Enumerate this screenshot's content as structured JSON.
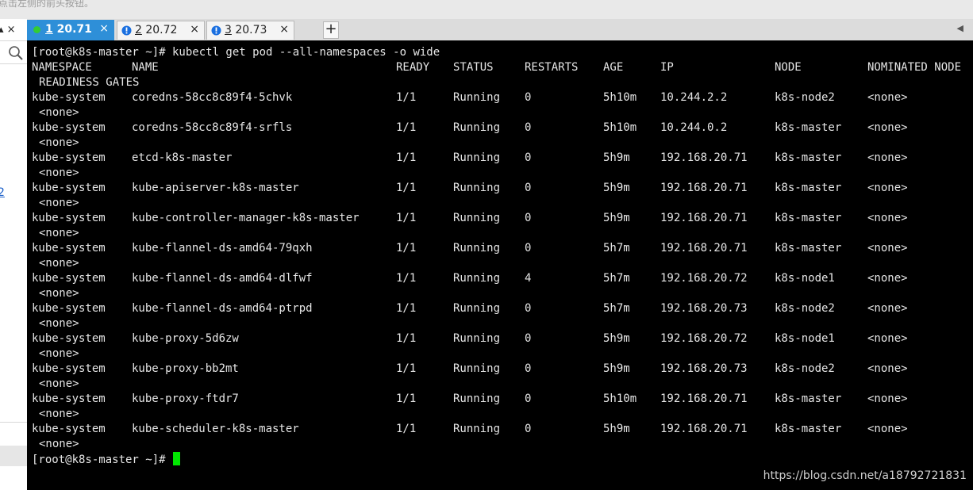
{
  "hint_text": "点击左侧的前头按钮。",
  "sidebar": {
    "controls_label": "▴ ×",
    "link_text": "2"
  },
  "tabs": [
    {
      "number": "1",
      "label": " 20.71",
      "status": "connected",
      "status_color": "#33cc33"
    },
    {
      "number": "2",
      "label": " 20.72",
      "status": "warning",
      "status_color": "#1a6fe0"
    },
    {
      "number": "3",
      "label": " 20.73",
      "status": "warning",
      "status_color": "#1a6fe0"
    }
  ],
  "new_tab_label": "+",
  "tab_close_label": "×",
  "terminal": {
    "prompt": "[root@k8s-master ~]#",
    "command": " kubectl get pod --all-namespaces -o wide",
    "headers": [
      "NAMESPACE",
      "NAME",
      "READY",
      "STATUS",
      "RESTARTS",
      "AGE",
      "IP",
      "NODE",
      "NOMINATED NODE"
    ],
    "headers_wrap": "READINESS GATES",
    "rows": [
      {
        "namespace": "kube-system",
        "name": "coredns-58cc8c89f4-5chvk",
        "ready": "1/1",
        "status": "Running",
        "restarts": "0",
        "age": "5h10m",
        "ip": "10.244.2.2",
        "node": "k8s-node2",
        "nominated": "<none>",
        "gates": "<none>"
      },
      {
        "namespace": "kube-system",
        "name": "coredns-58cc8c89f4-srfls",
        "ready": "1/1",
        "status": "Running",
        "restarts": "0",
        "age": "5h10m",
        "ip": "10.244.0.2",
        "node": "k8s-master",
        "nominated": "<none>",
        "gates": "<none>"
      },
      {
        "namespace": "kube-system",
        "name": "etcd-k8s-master",
        "ready": "1/1",
        "status": "Running",
        "restarts": "0",
        "age": "5h9m",
        "ip": "192.168.20.71",
        "node": "k8s-master",
        "nominated": "<none>",
        "gates": "<none>"
      },
      {
        "namespace": "kube-system",
        "name": "kube-apiserver-k8s-master",
        "ready": "1/1",
        "status": "Running",
        "restarts": "0",
        "age": "5h9m",
        "ip": "192.168.20.71",
        "node": "k8s-master",
        "nominated": "<none>",
        "gates": "<none>"
      },
      {
        "namespace": "kube-system",
        "name": "kube-controller-manager-k8s-master",
        "ready": "1/1",
        "status": "Running",
        "restarts": "0",
        "age": "5h9m",
        "ip": "192.168.20.71",
        "node": "k8s-master",
        "nominated": "<none>",
        "gates": "<none>"
      },
      {
        "namespace": "kube-system",
        "name": "kube-flannel-ds-amd64-79qxh",
        "ready": "1/1",
        "status": "Running",
        "restarts": "0",
        "age": "5h7m",
        "ip": "192.168.20.71",
        "node": "k8s-master",
        "nominated": "<none>",
        "gates": "<none>"
      },
      {
        "namespace": "kube-system",
        "name": "kube-flannel-ds-amd64-dlfwf",
        "ready": "1/1",
        "status": "Running",
        "restarts": "4",
        "age": "5h7m",
        "ip": "192.168.20.72",
        "node": "k8s-node1",
        "nominated": "<none>",
        "gates": "<none>"
      },
      {
        "namespace": "kube-system",
        "name": "kube-flannel-ds-amd64-ptrpd",
        "ready": "1/1",
        "status": "Running",
        "restarts": "0",
        "age": "5h7m",
        "ip": "192.168.20.73",
        "node": "k8s-node2",
        "nominated": "<none>",
        "gates": "<none>"
      },
      {
        "namespace": "kube-system",
        "name": "kube-proxy-5d6zw",
        "ready": "1/1",
        "status": "Running",
        "restarts": "0",
        "age": "5h9m",
        "ip": "192.168.20.72",
        "node": "k8s-node1",
        "nominated": "<none>",
        "gates": "<none>"
      },
      {
        "namespace": "kube-system",
        "name": "kube-proxy-bb2mt",
        "ready": "1/1",
        "status": "Running",
        "restarts": "0",
        "age": "5h9m",
        "ip": "192.168.20.73",
        "node": "k8s-node2",
        "nominated": "<none>",
        "gates": "<none>"
      },
      {
        "namespace": "kube-system",
        "name": "kube-proxy-ftdr7",
        "ready": "1/1",
        "status": "Running",
        "restarts": "0",
        "age": "5h10m",
        "ip": "192.168.20.71",
        "node": "k8s-master",
        "nominated": "<none>",
        "gates": "<none>"
      },
      {
        "namespace": "kube-system",
        "name": "kube-scheduler-k8s-master",
        "ready": "1/1",
        "status": "Running",
        "restarts": "0",
        "age": "5h9m",
        "ip": "192.168.20.71",
        "node": "k8s-master",
        "nominated": "<none>",
        "gates": "<none>"
      }
    ],
    "final_prompt": "[root@k8s-master ~]#",
    "cursor_color": "#00e600",
    "text_color": "#e6e6e6"
  },
  "watermark": "https://blog.csdn.net/a18792721831"
}
